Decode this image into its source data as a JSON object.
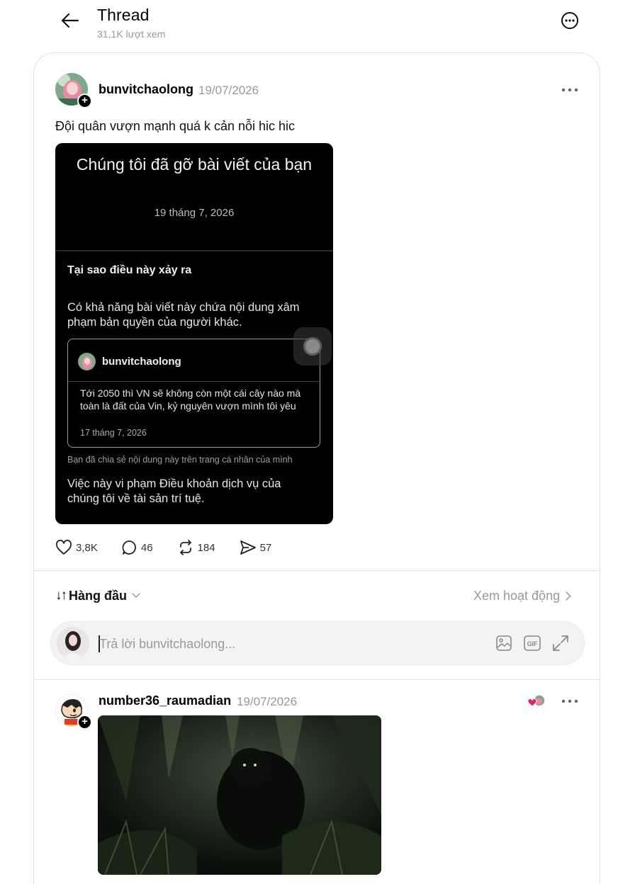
{
  "header": {
    "title": "Thread",
    "views": "31,1K lượt xem"
  },
  "post": {
    "username": "bunvitchaolong",
    "date": "19/07/2026",
    "text": "Đội quân vượn mạnh quá k cản nỗi hic hic",
    "screenshot": {
      "heading": "Chúng tôi đã gỡ bài viết của bạn",
      "date": "19 tháng 7, 2026",
      "why_title": "Tại sao điều này xảy ra",
      "reason": "Có khả năng bài viết này chứa nội dung xâm phạm bản quyền của người khác.",
      "original_post": {
        "username": "bunvitchaolong",
        "text": "Tới 2050 thì VN sẽ không còn một cái cây nào mà toàn là đất của Vin, kỷ nguyên vượn mình tôi yêu",
        "date": "17 tháng 7, 2026"
      },
      "shared_note": "Bạn đã chia sẻ nội dung này trên trang cá nhân của mình",
      "violation": "Việc này vi phạm Điều khoản dịch vụ của chúng tôi về tài sản trí tuệ."
    },
    "stats": {
      "likes": "3,8K",
      "comments": "46",
      "reposts": "184",
      "shares": "57"
    }
  },
  "sort": {
    "label": "Hàng đầu",
    "activity_link": "Xem hoạt động"
  },
  "reply": {
    "placeholder": "Trả lời bunvitchaolong..."
  },
  "comment": {
    "username": "number36_raumadian",
    "date": "19/07/2026"
  },
  "colors": {
    "muted_text": "#999999",
    "border": "#e2e2e2",
    "like_heart": "#e0245e"
  }
}
